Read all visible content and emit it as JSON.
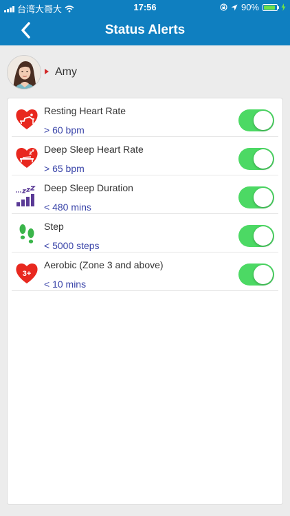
{
  "status_bar": {
    "carrier": "台湾大哥大",
    "time": "17:56",
    "battery": "90%"
  },
  "header": {
    "title": "Status Alerts"
  },
  "profile": {
    "name": "Amy"
  },
  "alerts": [
    {
      "label": "Resting Heart Rate",
      "value": "> 60 bpm",
      "icon": "heart-bed-icon",
      "enabled": true
    },
    {
      "label": "Deep Sleep Heart Rate",
      "value": "> 65 bpm",
      "icon": "heart-sleep-icon",
      "enabled": true
    },
    {
      "label": "Deep Sleep Duration",
      "value": "< 480 mins",
      "icon": "sleep-bars-icon",
      "enabled": true
    },
    {
      "label": "Step",
      "value": "< 5000 steps",
      "icon": "footprints-icon",
      "enabled": true
    },
    {
      "label": "Aerobic (Zone 3 and above)",
      "value": "< 10 mins",
      "icon": "heart-zone-icon",
      "icon_text": "3+",
      "enabled": true
    }
  ],
  "colors": {
    "header": "#0f7fc0",
    "toggle_on": "#4cd964",
    "value_text": "#3843a8",
    "heart_red": "#e8281f",
    "sleep_purple": "#5a3a96",
    "step_green": "#3ab54a"
  }
}
